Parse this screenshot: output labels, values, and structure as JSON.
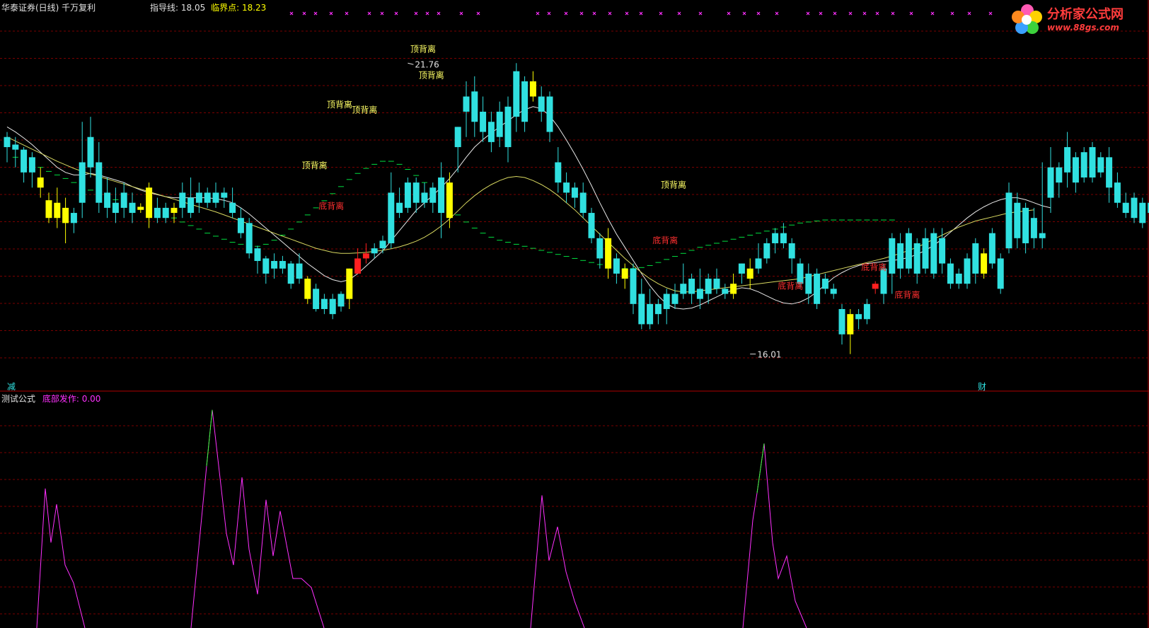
{
  "header": {
    "title": "华泰证券(日线) 千万复利",
    "guide_label": "指导线:",
    "guide_value": "18.05",
    "critical_label": "临界点:",
    "critical_value": "18.23"
  },
  "watermark": {
    "brand": "分析家公式网",
    "url": "www.88gs.com"
  },
  "main_marks": {
    "left": "减",
    "right": "财"
  },
  "sub_panel": {
    "name": "测试公式",
    "indicator_label": "底部发作:",
    "indicator_value": "0.00"
  },
  "colors": {
    "up": "#ff2020",
    "down": "#30e0e0",
    "yellow": "#ffff00",
    "ma_white": "#e8e8e8",
    "ma_yellow": "#d8d860",
    "guide_green": "#00e040",
    "sub_line": "#ff30ff",
    "sub_peak": "#30ff30",
    "grid": "#7a0000"
  },
  "chart_data": {
    "type": "candlestick",
    "ylim_main": [
      15.6,
      22.7
    ],
    "annotations": {
      "high": {
        "index": 48,
        "price": 21.76,
        "text": "21.76"
      },
      "low": {
        "index": 89,
        "price": 16.01,
        "text": "16.01"
      },
      "top_divergence": [
        {
          "index": 37,
          "price": 19.68,
          "text": "顶背离"
        },
        {
          "index": 40,
          "price": 20.88,
          "text": "顶背离"
        },
        {
          "index": 43,
          "price": 20.78,
          "text": "顶背离"
        },
        {
          "index": 50,
          "price": 21.98,
          "text": "顶背离"
        },
        {
          "index": 51,
          "price": 21.46,
          "text": "顶背离"
        },
        {
          "index": 80,
          "price": 19.3,
          "text": "顶背离"
        }
      ],
      "bottom_divergence": [
        {
          "index": 39,
          "price": 18.88,
          "text": "底背离"
        },
        {
          "index": 79,
          "price": 18.2,
          "text": "底背离"
        },
        {
          "index": 94,
          "price": 17.3,
          "text": "底背离"
        },
        {
          "index": 104,
          "price": 17.67,
          "text": "底背离"
        },
        {
          "index": 108,
          "price": 17.12,
          "text": "底背离"
        }
      ]
    },
    "candles": [
      [
        20.3,
        20.1,
        20.4,
        19.8
      ],
      [
        20.15,
        20.05,
        20.3,
        19.7
      ],
      [
        20.05,
        19.6,
        20.1,
        19.4
      ],
      [
        19.9,
        19.6,
        20.0,
        19.3
      ],
      [
        19.5,
        19.3,
        19.7,
        19.1
      ],
      [
        19.05,
        18.7,
        19.2,
        18.6
      ],
      [
        19.0,
        18.7,
        19.3,
        18.5
      ],
      [
        18.9,
        18.6,
        19.1,
        18.2
      ],
      [
        18.8,
        18.6,
        18.9,
        18.4
      ],
      [
        19.8,
        19.0,
        20.6,
        18.7
      ],
      [
        20.3,
        19.7,
        20.7,
        19.5
      ],
      [
        19.8,
        19.0,
        20.2,
        18.8
      ],
      [
        19.2,
        18.9,
        19.5,
        18.7
      ],
      [
        19.0,
        18.8,
        19.3,
        18.6
      ],
      [
        19.2,
        18.9,
        19.4,
        18.7
      ],
      [
        19.0,
        18.8,
        19.2,
        18.6
      ],
      [
        18.92,
        18.86,
        18.99,
        18.8
      ],
      [
        19.3,
        18.7,
        19.4,
        18.5
      ],
      [
        18.9,
        18.7,
        19.1,
        18.6
      ],
      [
        18.9,
        18.7,
        19.0,
        18.6
      ],
      [
        18.9,
        18.8,
        19.0,
        18.6
      ],
      [
        19.2,
        18.9,
        19.4,
        18.7
      ],
      [
        19.1,
        18.8,
        19.5,
        18.7
      ],
      [
        19.2,
        19.0,
        19.4,
        18.8
      ],
      [
        19.2,
        19.0,
        19.3,
        18.9
      ],
      [
        19.2,
        19.0,
        19.4,
        18.9
      ],
      [
        19.2,
        19.1,
        19.3,
        18.9
      ],
      [
        19.0,
        18.8,
        19.3,
        18.7
      ],
      [
        18.7,
        18.4,
        18.9,
        18.3
      ],
      [
        18.6,
        18.0,
        18.7,
        17.9
      ],
      [
        18.1,
        17.85,
        18.15,
        17.6
      ],
      [
        17.9,
        17.6,
        17.95,
        17.4
      ],
      [
        17.85,
        17.7,
        18.0,
        17.5
      ],
      [
        17.85,
        17.7,
        17.95,
        17.6
      ],
      [
        17.8,
        17.4,
        17.85,
        17.3
      ],
      [
        17.8,
        17.5,
        18.0,
        17.4
      ],
      [
        17.5,
        17.1,
        17.55,
        17.0
      ],
      [
        17.3,
        16.9,
        17.4,
        16.85
      ],
      [
        17.1,
        16.9,
        17.2,
        16.8
      ],
      [
        17.1,
        16.8,
        17.2,
        16.7
      ],
      [
        17.2,
        16.95,
        17.25,
        16.85
      ],
      [
        17.7,
        17.1,
        17.7,
        16.9
      ],
      [
        17.6,
        17.9,
        18.1,
        17.6
      ],
      [
        17.9,
        18.0,
        18.2,
        17.8
      ],
      [
        18.1,
        18.0,
        18.2,
        17.9
      ],
      [
        18.25,
        18.1,
        18.35,
        18.0
      ],
      [
        19.2,
        18.2,
        19.6,
        18.1
      ],
      [
        19.0,
        18.8,
        19.3,
        18.7
      ],
      [
        19.4,
        18.9,
        19.5,
        18.8
      ],
      [
        19.4,
        19.0,
        19.5,
        18.8
      ],
      [
        19.2,
        19.0,
        19.4,
        18.9
      ],
      [
        19.3,
        19.0,
        19.4,
        18.8
      ],
      [
        19.5,
        18.8,
        19.8,
        18.3
      ],
      [
        19.4,
        18.7,
        19.6,
        18.5
      ],
      [
        20.5,
        20.1,
        20.5,
        19.6
      ],
      [
        21.1,
        20.8,
        21.4,
        20.3
      ],
      [
        21.2,
        20.6,
        21.5,
        20.3
      ],
      [
        20.8,
        20.4,
        21.1,
        20.2
      ],
      [
        20.6,
        20.2,
        20.8,
        20.0
      ],
      [
        20.8,
        20.3,
        21.0,
        20.1
      ],
      [
        20.9,
        20.1,
        21.1,
        19.8
      ],
      [
        21.6,
        20.7,
        21.76,
        20.4
      ],
      [
        21.4,
        20.6,
        21.5,
        20.4
      ],
      [
        21.4,
        21.1,
        21.6,
        21.0
      ],
      [
        21.1,
        20.8,
        21.3,
        20.6
      ],
      [
        21.1,
        20.4,
        21.2,
        20.2
      ],
      [
        19.8,
        19.4,
        20.1,
        19.2
      ],
      [
        19.4,
        19.2,
        19.6,
        19.0
      ],
      [
        19.3,
        19.1,
        19.4,
        18.9
      ],
      [
        19.2,
        18.8,
        19.4,
        18.7
      ],
      [
        18.8,
        18.3,
        18.9,
        18.2
      ],
      [
        18.3,
        17.9,
        18.4,
        17.7
      ],
      [
        18.3,
        17.7,
        18.5,
        17.5
      ],
      [
        17.9,
        17.6,
        18.0,
        17.4
      ],
      [
        17.7,
        17.5,
        17.8,
        17.3
      ],
      [
        17.7,
        17.0,
        17.8,
        16.8
      ],
      [
        17.2,
        16.6,
        17.5,
        16.5
      ],
      [
        17.0,
        16.6,
        17.3,
        16.5
      ],
      [
        17.0,
        16.8,
        17.1,
        16.6
      ],
      [
        17.2,
        16.9,
        17.3,
        16.6
      ],
      [
        17.2,
        17.0,
        17.4,
        16.9
      ],
      [
        17.4,
        17.2,
        17.8,
        17.1
      ],
      [
        17.5,
        17.2,
        17.6,
        17.0
      ],
      [
        17.3,
        17.1,
        17.7,
        16.9
      ],
      [
        17.5,
        17.2,
        17.6,
        17.0
      ],
      [
        17.5,
        17.3,
        17.7,
        17.2
      ],
      [
        17.3,
        17.2,
        17.4,
        17.1
      ],
      [
        17.4,
        17.2,
        17.6,
        17.1
      ],
      [
        17.8,
        17.6,
        17.8,
        17.4
      ],
      [
        17.7,
        17.5,
        17.9,
        17.3
      ],
      [
        17.9,
        17.7,
        18.2,
        17.6
      ],
      [
        18.2,
        17.9,
        18.3,
        17.8
      ],
      [
        18.4,
        18.2,
        18.5,
        18.0
      ],
      [
        18.4,
        18.2,
        18.6,
        18.1
      ],
      [
        18.2,
        17.9,
        18.3,
        17.6
      ],
      [
        17.8,
        17.4,
        17.9,
        17.3
      ],
      [
        17.6,
        17.2,
        17.8,
        17.0
      ],
      [
        17.6,
        17.0,
        17.7,
        16.9
      ],
      [
        17.5,
        17.3,
        17.6,
        17.2
      ],
      [
        17.3,
        17.2,
        17.4,
        17.1
      ],
      [
        16.9,
        16.4,
        17.0,
        16.2
      ],
      [
        16.8,
        16.4,
        16.9,
        16.01
      ],
      [
        16.8,
        16.7,
        16.9,
        16.5
      ],
      [
        17.0,
        16.7,
        17.1,
        16.6
      ],
      [
        17.3,
        17.4,
        17.45,
        17.2
      ],
      [
        17.7,
        17.2,
        17.8,
        17.0
      ],
      [
        18.3,
        17.6,
        18.4,
        17.2
      ],
      [
        18.2,
        17.7,
        18.4,
        17.5
      ],
      [
        18.4,
        17.7,
        18.5,
        17.6
      ],
      [
        18.2,
        17.6,
        18.3,
        17.4
      ],
      [
        18.3,
        17.7,
        18.5,
        17.6
      ],
      [
        18.4,
        17.6,
        18.5,
        17.5
      ],
      [
        18.3,
        17.8,
        18.5,
        17.6
      ],
      [
        17.8,
        17.4,
        17.9,
        17.3
      ],
      [
        17.6,
        17.4,
        17.7,
        17.3
      ],
      [
        17.9,
        17.4,
        18.0,
        17.3
      ],
      [
        18.2,
        17.6,
        18.3,
        17.4
      ],
      [
        18.0,
        17.6,
        18.1,
        17.5
      ],
      [
        18.4,
        17.8,
        18.5,
        17.7
      ],
      [
        17.9,
        17.3,
        18.0,
        17.2
      ],
      [
        19.2,
        18.1,
        19.4,
        18.0
      ],
      [
        19.0,
        18.3,
        19.2,
        18.1
      ],
      [
        18.9,
        18.2,
        19.0,
        18.0
      ],
      [
        18.7,
        18.3,
        18.9,
        18.1
      ],
      [
        18.4,
        18.3,
        19.8,
        18.1
      ],
      [
        19.7,
        19.1,
        20.1,
        18.8
      ],
      [
        19.7,
        19.4,
        19.8,
        19.1
      ],
      [
        20.1,
        19.6,
        20.4,
        19.3
      ],
      [
        19.9,
        19.4,
        20.0,
        19.2
      ],
      [
        20.0,
        19.5,
        20.1,
        19.4
      ],
      [
        20.1,
        19.5,
        20.2,
        19.4
      ],
      [
        19.9,
        19.6,
        20.0,
        19.5
      ],
      [
        19.9,
        19.3,
        20.1,
        19.0
      ],
      [
        19.4,
        19.0,
        19.6,
        18.9
      ],
      [
        19.0,
        18.8,
        19.2,
        18.7
      ],
      [
        19.1,
        18.7,
        19.2,
        18.6
      ],
      [
        19.0,
        18.6,
        19.1,
        18.5
      ],
      [
        19.0,
        18.8,
        19.1,
        18.6
      ],
      [
        19.3,
        18.9,
        19.3,
        18.7
      ],
      [
        19.1,
        18.6,
        19.3,
        18.4
      ],
      [
        18.8,
        18.4,
        19.0,
        18.2
      ],
      [
        18.6,
        18.3,
        18.7,
        18.1
      ]
    ],
    "yellow_indices": [
      4,
      5,
      6,
      7,
      16,
      17,
      20,
      36,
      41,
      53,
      63,
      72,
      74,
      87,
      89,
      101,
      117
    ],
    "ma_white": [
      20.5,
      20.4,
      20.28,
      20.15,
      20.0,
      19.85,
      19.7,
      19.6,
      19.55,
      19.55,
      19.58,
      19.55,
      19.5,
      19.45,
      19.4,
      19.32,
      19.25,
      19.2,
      19.16,
      19.12,
      19.1,
      19.1,
      19.1,
      19.1,
      19.1,
      19.08,
      19.05,
      19.0,
      18.9,
      18.78,
      18.64,
      18.5,
      18.36,
      18.22,
      18.08,
      17.94,
      17.8,
      17.68,
      17.56,
      17.48,
      17.44,
      17.48,
      17.6,
      17.75,
      17.9,
      18.05,
      18.25,
      18.45,
      18.65,
      18.85,
      19.0,
      19.15,
      19.3,
      19.48,
      19.68,
      19.9,
      20.1,
      20.25,
      20.38,
      20.5,
      20.62,
      20.74,
      20.84,
      20.9,
      20.86,
      20.72,
      20.5,
      20.24,
      19.96,
      19.66,
      19.34,
      19.0,
      18.68,
      18.38,
      18.12,
      17.86,
      17.6,
      17.36,
      17.16,
      17.0,
      16.92,
      16.9,
      16.92,
      16.98,
      17.06,
      17.14,
      17.22,
      17.28,
      17.32,
      17.3,
      17.24,
      17.16,
      17.08,
      17.02,
      17.0,
      17.04,
      17.12,
      17.24,
      17.38,
      17.52,
      17.62,
      17.7,
      17.76,
      17.8,
      17.82,
      17.84,
      17.86,
      17.88,
      17.92,
      17.98,
      18.06,
      18.16,
      18.28,
      18.42,
      18.56,
      18.7,
      18.82,
      18.92,
      19.0,
      19.06,
      19.1,
      19.1,
      19.06,
      19.0,
      18.94,
      18.9
    ],
    "ma_yellow": [
      20.3,
      20.22,
      20.14,
      20.06,
      19.98,
      19.9,
      19.82,
      19.75,
      19.68,
      19.62,
      19.57,
      19.52,
      19.47,
      19.42,
      19.37,
      19.32,
      19.27,
      19.22,
      19.17,
      19.12,
      19.07,
      19.02,
      18.97,
      18.92,
      18.87,
      18.82,
      18.76,
      18.7,
      18.64,
      18.58,
      18.52,
      18.46,
      18.4,
      18.34,
      18.28,
      18.22,
      18.16,
      18.1,
      18.06,
      18.02,
      18.0,
      18.0,
      18.01,
      18.02,
      18.04,
      18.06,
      18.09,
      18.13,
      18.18,
      18.24,
      18.32,
      18.42,
      18.54,
      18.68,
      18.84,
      19.0,
      19.14,
      19.26,
      19.36,
      19.44,
      19.5,
      19.52,
      19.5,
      19.44,
      19.36,
      19.26,
      19.14,
      19.0,
      18.86,
      18.7,
      18.54,
      18.38,
      18.22,
      18.06,
      17.9,
      17.76,
      17.62,
      17.5,
      17.4,
      17.32,
      17.26,
      17.24,
      17.24,
      17.26,
      17.28,
      17.3,
      17.32,
      17.34,
      17.36,
      17.38,
      17.4,
      17.42,
      17.44,
      17.46,
      17.48,
      17.5,
      17.54,
      17.58,
      17.62,
      17.66,
      17.7,
      17.74,
      17.78,
      17.82,
      17.86,
      17.9,
      17.95,
      18.0,
      18.06,
      18.12,
      18.2,
      18.28,
      18.36,
      18.44,
      18.52,
      18.58,
      18.64,
      18.68,
      18.72,
      18.76,
      18.8,
      18.82,
      18.84,
      18.86
    ],
    "guide_dashes": [
      19.9,
      19.85,
      19.78,
      19.7,
      19.62,
      19.55,
      19.48,
      19.4,
      19.32,
      19.25,
      19.18,
      19.12,
      19.06,
      19.0,
      18.95,
      18.9,
      18.85,
      18.8,
      18.75,
      18.7,
      18.62,
      18.55,
      18.48,
      18.4,
      18.34,
      18.28,
      18.22,
      18.18,
      18.15,
      18.14,
      18.18,
      18.26,
      18.36,
      18.48,
      18.62,
      18.76,
      18.9,
      19.04,
      19.18,
      19.32,
      19.46,
      19.58,
      19.68,
      19.76,
      19.82,
      19.82,
      19.76,
      19.66,
      19.54,
      19.4,
      19.24,
      19.08,
      18.92,
      18.76,
      18.62,
      18.5,
      18.4,
      18.32,
      18.26,
      18.22,
      18.18,
      18.14,
      18.1,
      18.06,
      18.02,
      17.98,
      17.94,
      17.9,
      17.86,
      17.82,
      17.78,
      17.74,
      17.72,
      17.7,
      17.7,
      17.72,
      17.76,
      17.82,
      17.88,
      17.94,
      18.0,
      18.06,
      18.12,
      18.16,
      18.2,
      18.24,
      18.28,
      18.32,
      18.36,
      18.4,
      18.44,
      18.48,
      18.52,
      18.56,
      18.6,
      18.62,
      18.64,
      18.66,
      18.66,
      18.66,
      18.66,
      18.66,
      18.66,
      18.66,
      18.66,
      18.66
    ],
    "sub_series": [
      0,
      0,
      0,
      0,
      0,
      0,
      0,
      0,
      0,
      0,
      0,
      0,
      0,
      0,
      0,
      0,
      0,
      0,
      0,
      0,
      0,
      0,
      0,
      0,
      0,
      0,
      0,
      0,
      0,
      0,
      0,
      0,
      0,
      0,
      0,
      0,
      0,
      0,
      0,
      0,
      0,
      0,
      0,
      0,
      0,
      0,
      0,
      0,
      0,
      0,
      0,
      0,
      0,
      0,
      0,
      0,
      0,
      0,
      0,
      0,
      0,
      0,
      0,
      0,
      0,
      0,
      0,
      0,
      0,
      0,
      0,
      0,
      0,
      0,
      0,
      0,
      0,
      0,
      0,
      0,
      0,
      0,
      0,
      0,
      0,
      0,
      0,
      0,
      0,
      0,
      0,
      0,
      0,
      0,
      0,
      0,
      0,
      0,
      0,
      0,
      0,
      0,
      0,
      0,
      0,
      0,
      0,
      0,
      0,
      0,
      0,
      0,
      0,
      0,
      0,
      0,
      0,
      0,
      0,
      0,
      0,
      0,
      0,
      0,
      0,
      0,
      0,
      0,
      0,
      0
    ]
  }
}
